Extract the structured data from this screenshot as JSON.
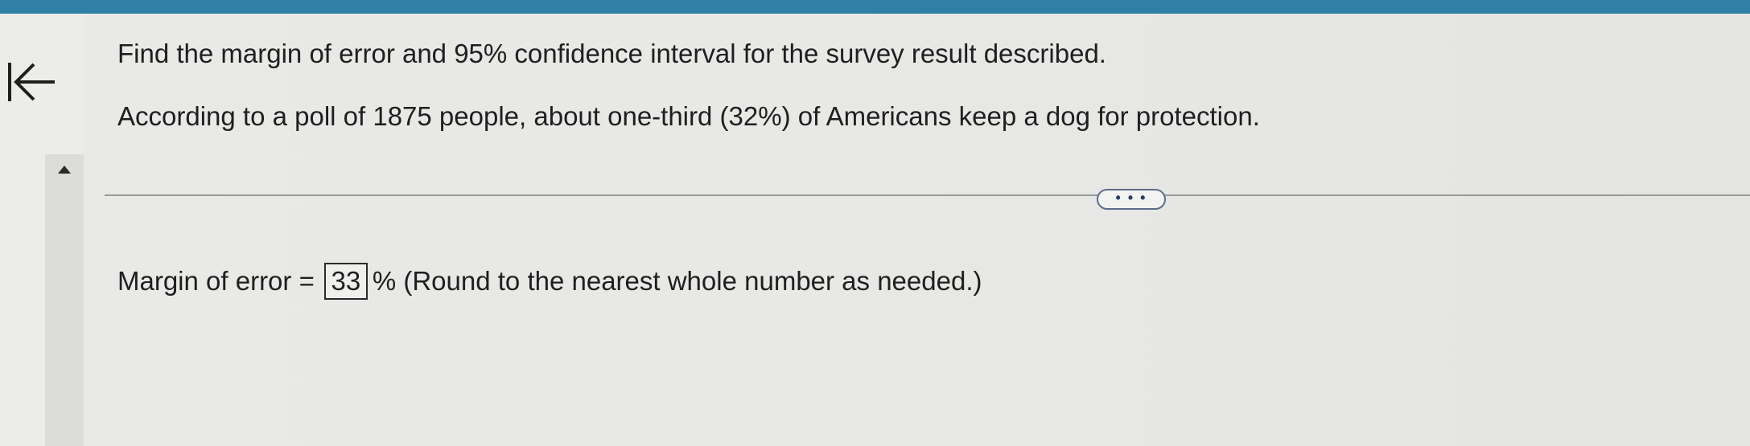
{
  "nav": {
    "back_icon": "back-to-start-icon",
    "scroll_icon": "triangle-up-icon"
  },
  "question": {
    "prompt": "Find the margin of error and 95% confidence interval for the survey result described.",
    "scenario": "According to a poll of 1875 people, about one-third (32%) of Americans keep a dog for protection."
  },
  "more_button": {
    "label": "• • •"
  },
  "answer": {
    "label": "Margin of error =",
    "value": "33",
    "unit_and_hint": "% (Round to the nearest whole number as needed.)"
  },
  "colors": {
    "top_bar": "#2f7fa6",
    "background": "#e6e6e4",
    "text": "#1f1f1f"
  }
}
